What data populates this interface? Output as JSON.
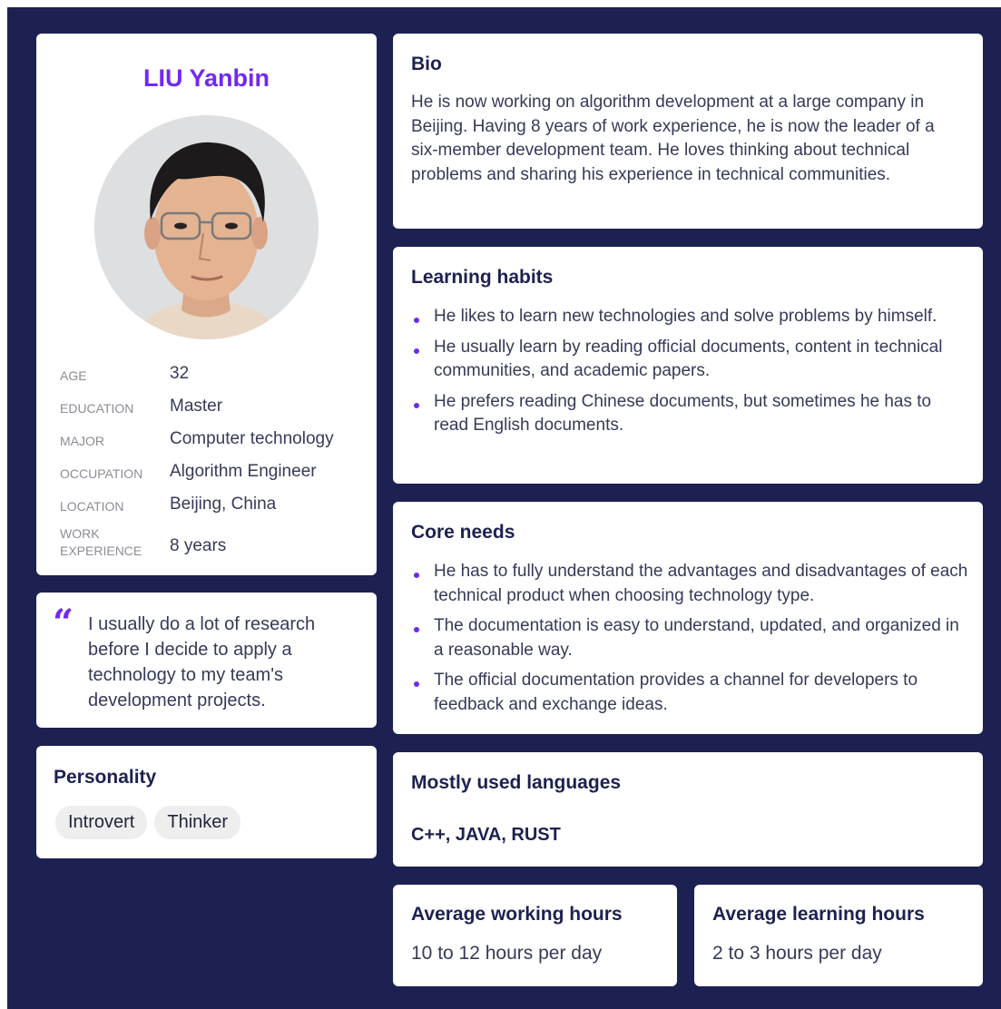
{
  "profile": {
    "name": "LIU Yanbin",
    "facts": [
      {
        "label": "AGE",
        "value": "32"
      },
      {
        "label": "EDUCATION",
        "value": "Master"
      },
      {
        "label": "MAJOR",
        "value": "Computer technology"
      },
      {
        "label": "OCCUPATION",
        "value": "Algorithm Engineer"
      },
      {
        "label": "LOCATION",
        "value": "Beijing, China"
      },
      {
        "label": "WORK EXPERIENCE",
        "value": "8 years"
      }
    ]
  },
  "quote": {
    "mark": "“",
    "text": "I usually do a lot of research before I decide to apply a technology to my team's development projects."
  },
  "personality": {
    "title": "Personality",
    "tags": [
      "Introvert",
      "Thinker"
    ]
  },
  "bio": {
    "title": "Bio",
    "text": "He is now working on algorithm development at a large company in Beijing. Having 8 years of work experience, he is now the leader of a six-member development team. He loves thinking about technical problems and sharing his experience in technical communities."
  },
  "habits": {
    "title": "Learning habits",
    "items": [
      "He likes to learn new technologies and solve problems by himself.",
      "He usually learn by reading official documents, content in technical communities, and  academic papers.",
      "He prefers reading Chinese documents, but sometimes he has to read English documents."
    ]
  },
  "needs": {
    "title": "Core needs",
    "items": [
      "He has to fully understand the advantages and disadvantages of each technical product when choosing technology type.",
      "The documentation is easy to understand, updated, and organized in a reasonable way.",
      "The official documentation provides a channel for developers to feedback and exchange ideas."
    ]
  },
  "languages": {
    "title": "Mostly used languages",
    "value": "C++, JAVA, RUST"
  },
  "working_hours": {
    "title": "Average working hours",
    "value": "10 to 12 hours per day"
  },
  "learning_hours": {
    "title": "Average learning hours",
    "value": "2 to 3 hours per day"
  },
  "colors": {
    "background": "#1d2151",
    "accent": "#7128f5",
    "card": "#ffffff"
  }
}
